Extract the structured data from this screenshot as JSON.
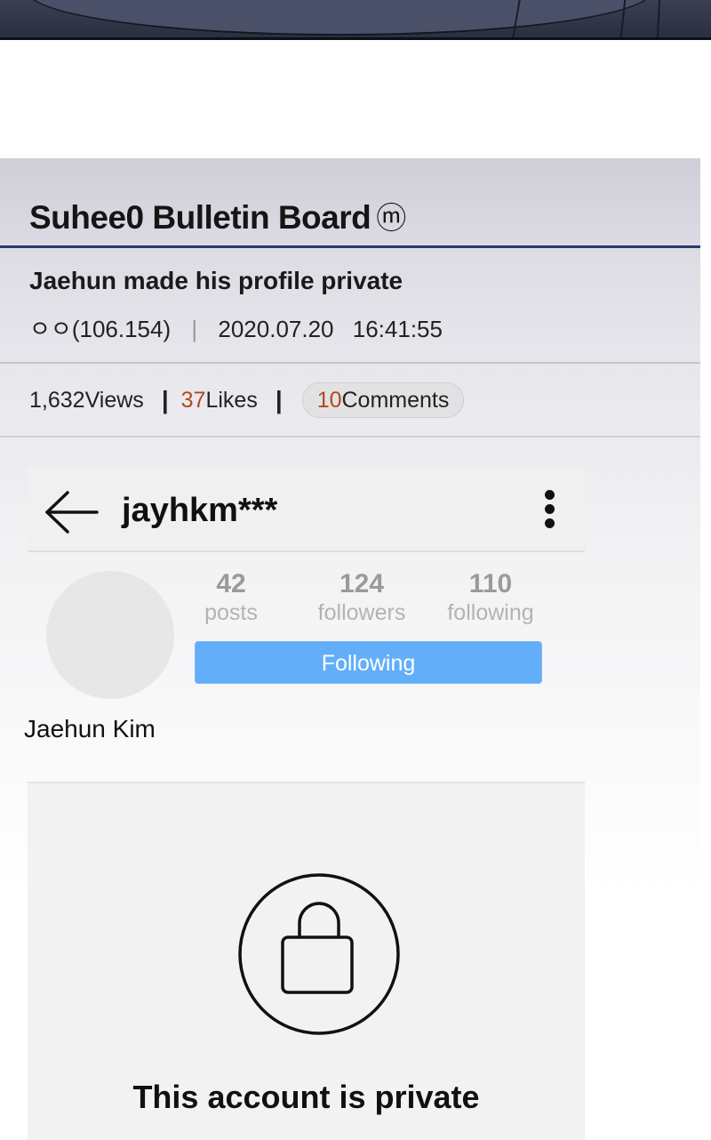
{
  "board": {
    "title": "Suhee0 Bulletin Board",
    "title_mark": "ⓜ"
  },
  "post": {
    "title": "Jaehun made his profile private",
    "author": "ㅇㅇ(106.154)",
    "separator": "|",
    "date": "2020.07.20",
    "time": "16:41:55"
  },
  "stats": {
    "views_count": "1,632",
    "views_label": " Views",
    "likes_count": "37",
    "likes_label": " Likes",
    "comments_count": "10",
    "comments_label": " Comments",
    "divider": "|"
  },
  "profile": {
    "username": "jayhkm***",
    "posts_count": "42",
    "posts_label": "posts",
    "followers_count": "124",
    "followers_label": "followers",
    "following_count": "110",
    "following_label": "following",
    "follow_button": "Following",
    "full_name": "Jaehun Kim",
    "private_message": "This account is private"
  },
  "colors": {
    "header_rule": "#2b3a6e",
    "likes_accent": "#b24a1a",
    "follow_button": "#63aef8"
  },
  "icons": {
    "back": "back-arrow-icon",
    "more": "more-vertical-icon",
    "lock": "lock-icon"
  }
}
